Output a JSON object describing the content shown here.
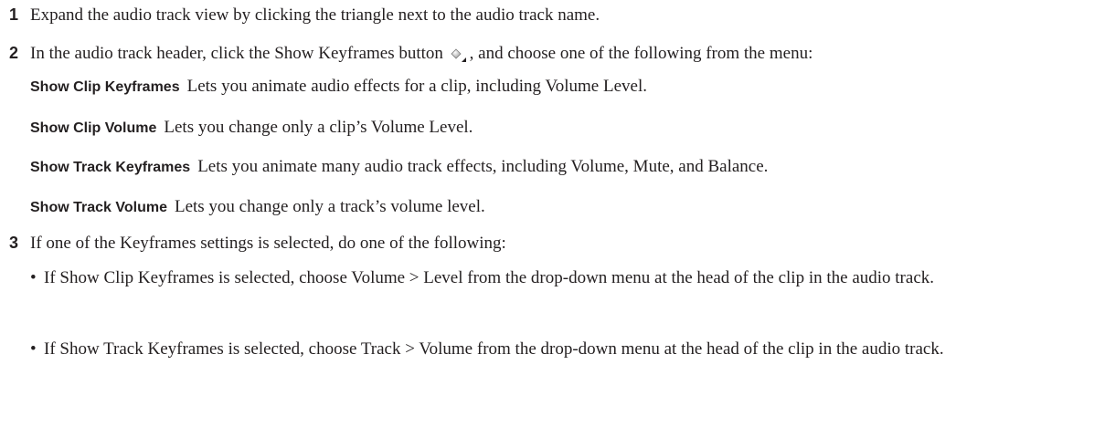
{
  "steps": [
    {
      "number": "1",
      "text": "Expand the audio track view by clicking the triangle next to the audio track name."
    },
    {
      "number": "2",
      "text_before": "In the audio track header, click the Show Keyframes button",
      "icon": "show-keyframes-icon",
      "text_after": ", and choose one of the following from the menu:",
      "definitions": [
        {
          "term": "Show Clip Keyframes",
          "desc": "Lets you animate audio effects for a clip, including Volume Level."
        },
        {
          "term": "Show Clip Volume",
          "desc": "Lets you change only a clip’s Volume Level."
        },
        {
          "term": "Show Track Keyframes",
          "desc": "Lets you animate many audio track effects, including Volume, Mute, and Balance."
        },
        {
          "term": "Show Track Volume",
          "desc": "Lets you change only a track’s volume level."
        }
      ]
    },
    {
      "number": "3",
      "text": "If one of the Keyframes settings is selected, do one of the following:",
      "bullets": [
        "If Show Clip Keyframes is selected, choose Volume > Level from the drop-down menu at the head of the clip in the audio track.",
        "If Show Track Keyframes is selected, choose Track > Volume from the drop-down menu at the head of the clip in the audio track."
      ]
    }
  ],
  "bullet_char": "•",
  "colors": {
    "text": "#231f20",
    "background": "#ffffff"
  }
}
